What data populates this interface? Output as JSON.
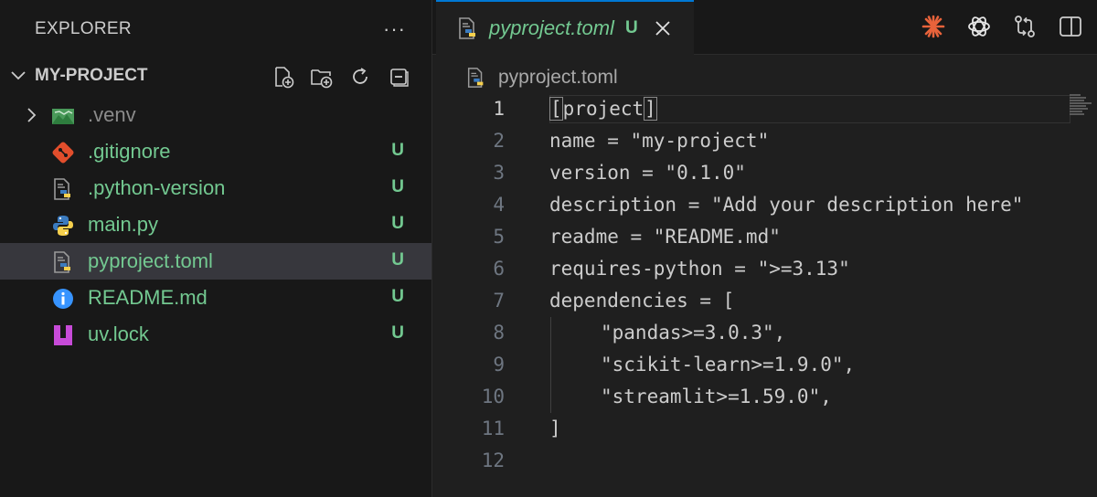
{
  "sidebar": {
    "header": "EXPLORER",
    "more": "···",
    "project": "MY-PROJECT",
    "actions": [
      "new-file",
      "new-folder",
      "refresh",
      "collapse-all"
    ],
    "files": [
      {
        "name": ".venv",
        "status": "",
        "icon": "folder-venv-icon",
        "color": "#8b8b8b",
        "expandable": true
      },
      {
        "name": ".gitignore",
        "status": "U",
        "icon": "git-icon",
        "color": "#73c991"
      },
      {
        "name": ".python-version",
        "status": "U",
        "icon": "python-file-icon",
        "color": "#73c991"
      },
      {
        "name": "main.py",
        "status": "U",
        "icon": "python-icon",
        "color": "#73c991"
      },
      {
        "name": "pyproject.toml",
        "status": "U",
        "icon": "python-file-icon",
        "color": "#73c991",
        "selected": true
      },
      {
        "name": "README.md",
        "status": "U",
        "icon": "info-icon",
        "color": "#73c991"
      },
      {
        "name": "uv.lock",
        "status": "U",
        "icon": "uv-lock-icon",
        "color": "#73c991"
      }
    ]
  },
  "tab": {
    "label": "pyproject.toml",
    "status": "U"
  },
  "breadcrumb": "pyproject.toml",
  "editor": {
    "lines": [
      {
        "n": "1",
        "text": "[project]",
        "active": true
      },
      {
        "n": "2",
        "text": "name = \"my-project\""
      },
      {
        "n": "3",
        "text": "version = \"0.1.0\""
      },
      {
        "n": "4",
        "text": "description = \"Add your description here\""
      },
      {
        "n": "5",
        "text": "readme = \"README.md\""
      },
      {
        "n": "6",
        "text": "requires-python = \">=3.13\""
      },
      {
        "n": "7",
        "text": "dependencies = ["
      },
      {
        "n": "8",
        "text": "\"pandas>=3.0.3\",",
        "indent": true
      },
      {
        "n": "9",
        "text": "\"scikit-learn>=1.9.0\",",
        "indent": true
      },
      {
        "n": "10",
        "text": "\"streamlit>=1.59.0\",",
        "indent": true
      },
      {
        "n": "11",
        "text": "]"
      },
      {
        "n": "12",
        "text": ""
      }
    ]
  },
  "colors": {
    "accent": "#0078d4",
    "untracked": "#73c991",
    "python_blue": "#3b7bbf",
    "python_yellow": "#f6d04d",
    "git": "#e24e2c",
    "info": "#3794ff",
    "uv": "#c74bd8",
    "claude": "#e8633b"
  }
}
